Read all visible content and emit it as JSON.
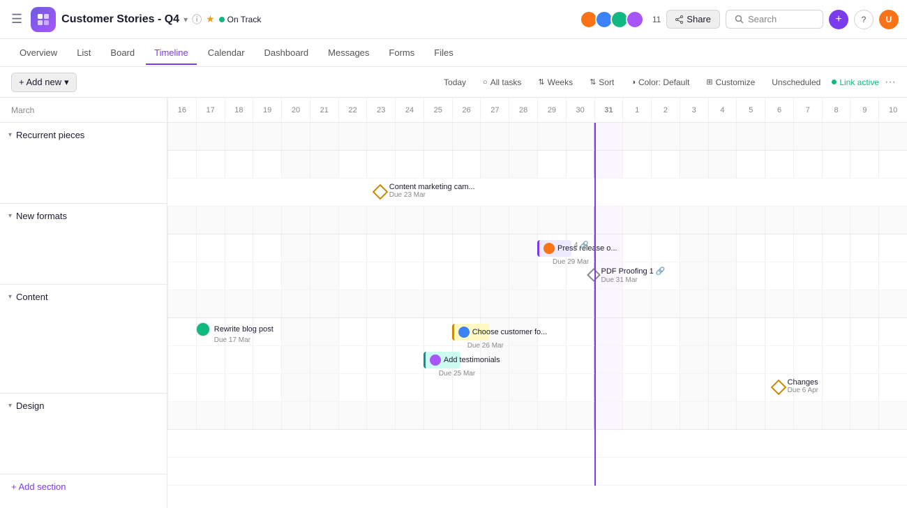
{
  "topbar": {
    "project_title": "Customer Stories - Q4",
    "status": "On Track",
    "avatar_count": "11",
    "share_label": "Share",
    "search_placeholder": "Search"
  },
  "nav": {
    "tabs": [
      "Overview",
      "List",
      "Board",
      "Timeline",
      "Calendar",
      "Dashboard",
      "Messages",
      "Forms",
      "Files"
    ],
    "active": "Timeline"
  },
  "toolbar": {
    "add_label": "+ Add new",
    "today_label": "Today",
    "all_tasks_label": "All tasks",
    "weeks_label": "Weeks",
    "sort_label": "Sort",
    "color_label": "Color: Default",
    "customize_label": "Customize",
    "unscheduled_label": "Unscheduled",
    "link_active_label": "Link active"
  },
  "dates": {
    "month_label": "March",
    "cells": [
      "16",
      "17",
      "18",
      "19",
      "20",
      "21",
      "22",
      "23",
      "24",
      "25",
      "26",
      "27",
      "28",
      "29",
      "30",
      "31",
      "1",
      "2",
      "3",
      "4",
      "5",
      "6",
      "7",
      "8",
      "9",
      "10"
    ]
  },
  "sections": [
    {
      "name": "Recurrent pieces",
      "id": "recurrent",
      "tasks": [
        {
          "id": "content-marketing",
          "label": "Content marketing cam...",
          "due": "Due 23 Mar",
          "type": "milestone",
          "col_start": 7
        }
      ]
    },
    {
      "name": "New formats",
      "id": "new-formats",
      "tasks": [
        {
          "id": "press-release",
          "label": "Press release o...",
          "due": "Due 29 Mar",
          "type": "bar-purple",
          "col_start": 13,
          "width": 1,
          "count": "4"
        },
        {
          "id": "pdf-proofing",
          "label": "PDF Proofing",
          "due": "Due 31 Mar",
          "type": "milestone-small",
          "col_start": 15,
          "count": "1"
        }
      ]
    },
    {
      "name": "Content",
      "id": "content",
      "tasks": [
        {
          "id": "rewrite-blog",
          "label": "Rewrite blog post",
          "due": "Due 17 Mar",
          "type": "card",
          "col_start": 1
        },
        {
          "id": "choose-customer",
          "label": "Choose customer fo...",
          "due": "Due 26 Mar",
          "type": "bar-yellow",
          "col_start": 10,
          "width": 1
        },
        {
          "id": "add-testimonials",
          "label": "Add testimonials",
          "due": "Due 25 Mar",
          "type": "bar-teal",
          "col_start": 9,
          "width": 1
        },
        {
          "id": "changes",
          "label": "Changes",
          "due": "Due 6 Apr",
          "type": "milestone",
          "col_start": 21
        }
      ]
    },
    {
      "name": "Design",
      "id": "design",
      "tasks": []
    }
  ],
  "add_section_label": "+ Add section"
}
